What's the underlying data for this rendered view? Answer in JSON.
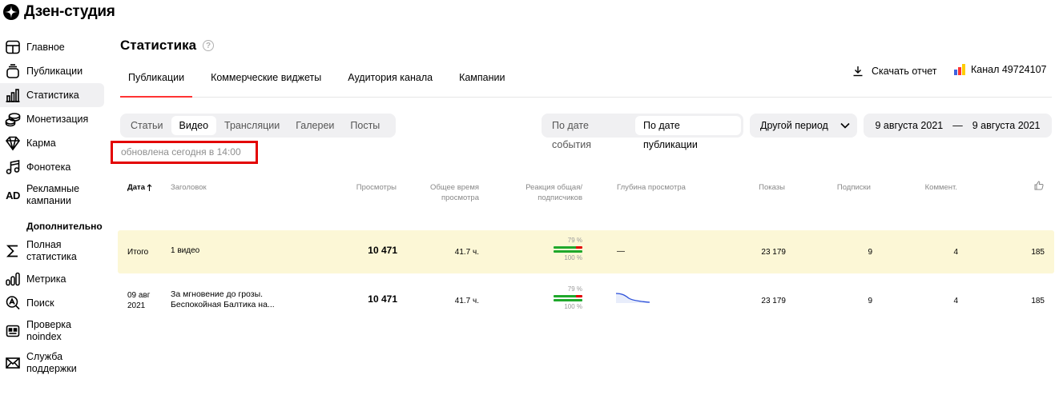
{
  "app": {
    "name": "Дзен-студия"
  },
  "sidebar": {
    "items": [
      {
        "label": "Главное",
        "icon": "home-grid-icon"
      },
      {
        "label": "Публикации",
        "icon": "stack-icon"
      },
      {
        "label": "Статистика",
        "icon": "bar-chart-icon",
        "active": true
      },
      {
        "label": "Монетизация",
        "icon": "coins-icon"
      },
      {
        "label": "Карма",
        "icon": "gem-icon"
      },
      {
        "label": "Фонотека",
        "icon": "music-note-icon"
      },
      {
        "label": "Рекламные кампании",
        "icon": "ad-icon",
        "icon_text": "AD"
      }
    ],
    "section_title": "Дополнительно",
    "extra_items": [
      {
        "label": "Полная статистика",
        "icon": "sigma-icon"
      },
      {
        "label": "Метрика",
        "icon": "metrica-icon"
      },
      {
        "label": "Поиск",
        "icon": "search-icon"
      },
      {
        "label": "Проверка noindex",
        "icon": "noindex-icon"
      },
      {
        "label": "Служба поддержки",
        "icon": "mail-icon"
      }
    ]
  },
  "header": {
    "title": "Статистика",
    "help": "?",
    "tabs": [
      {
        "label": "Публикации",
        "active": true
      },
      {
        "label": "Коммерческие виджеты"
      },
      {
        "label": "Аудитория канала"
      },
      {
        "label": "Кампании"
      }
    ],
    "download_label": "Скачать отчет",
    "channel_label": "Канал 49724107"
  },
  "filters": {
    "content_types": [
      {
        "label": "Статьи"
      },
      {
        "label": "Видео",
        "active": true
      },
      {
        "label": "Трансляции"
      },
      {
        "label": "Галереи"
      },
      {
        "label": "Посты"
      }
    ],
    "date_modes": [
      {
        "label": "По дате события"
      },
      {
        "label": "По дате публикации",
        "active": true
      }
    ],
    "period_label": "Другой период",
    "range_from": "9 августа 2021",
    "range_sep": "—",
    "range_to": "9 августа 2021"
  },
  "updated_text": "обновлена сегодня в 14:00",
  "table": {
    "headers": {
      "date": "Дата",
      "title": "Заголовок",
      "views": "Просмотры",
      "watch_time_1": "Общее время",
      "watch_time_2": "просмотра",
      "reaction_1": "Реакция общая/",
      "reaction_2": "подписчиков",
      "depth": "Глубина просмотра",
      "impressions": "Показы",
      "subscriptions": "Подписки",
      "comments": "Коммент."
    },
    "total": {
      "date": "Итого",
      "title": "1 видео",
      "views": "10 471",
      "watch_time": "41.7 ч.",
      "reaction_general": "79 %",
      "reaction_subscribers": "100 %",
      "reaction_general_value": 79,
      "reaction_subscribers_value": 100,
      "depth": "—",
      "impressions": "23 179",
      "subscriptions": "9",
      "comments": "4",
      "likes": "185"
    },
    "rows": [
      {
        "date_1": "09 авг",
        "date_2": "2021",
        "title_1": "За мгновение до грозы.",
        "title_2": "Беспокойная Балтика на...",
        "views": "10 471",
        "watch_time": "41.7 ч.",
        "reaction_general": "79 %",
        "reaction_subscribers": "100 %",
        "reaction_general_value": 79,
        "reaction_subscribers_value": 100,
        "impressions": "23 179",
        "subscriptions": "9",
        "comments": "4",
        "likes": "185"
      }
    ]
  },
  "colors": {
    "accent": "#ff3333",
    "highlight_box": "#e30000",
    "total_row_bg": "#fcf7d6",
    "bar_green": "#1fa82b",
    "bar_red": "#e30000",
    "sparkline": "#2b4fd9"
  }
}
